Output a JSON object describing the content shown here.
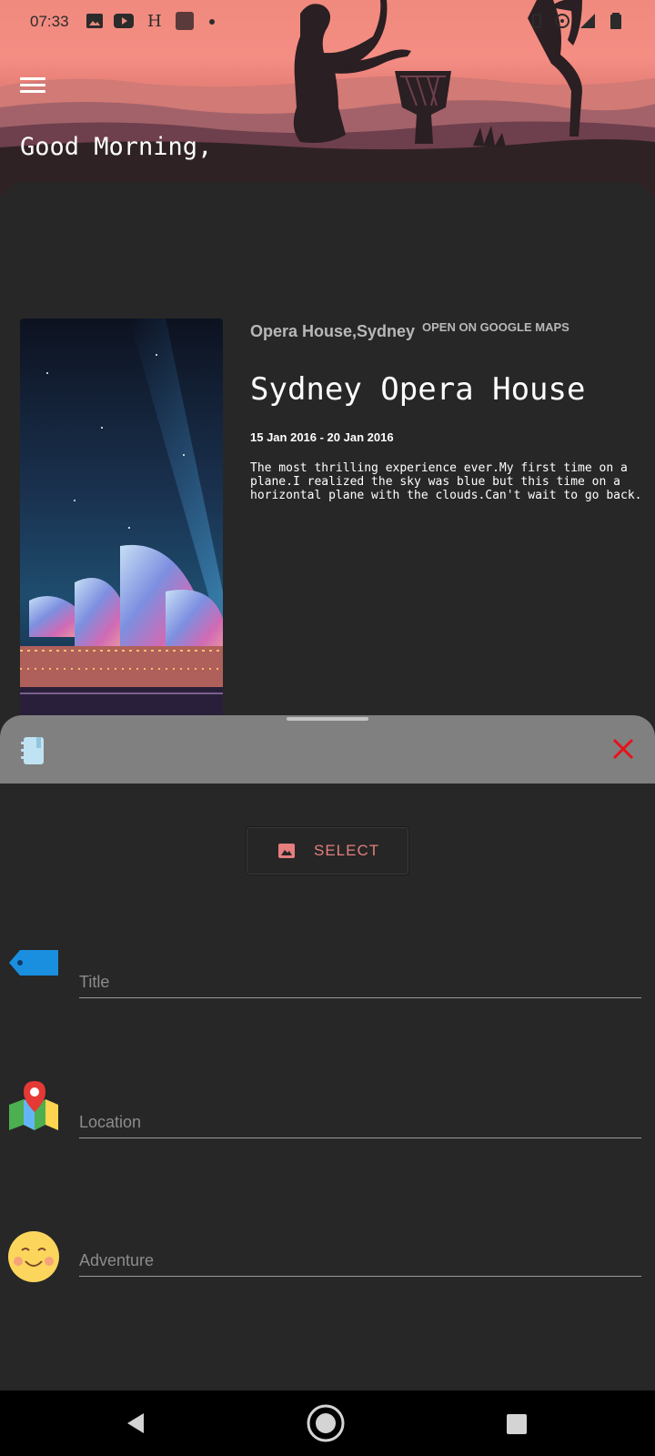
{
  "status_bar": {
    "time": "07:33",
    "icons": [
      "image-icon",
      "youtube-icon",
      "h-icon",
      "square-icon",
      "dot-icon",
      "vibrate-icon",
      "hotspot-icon",
      "signal-icon",
      "battery-icon"
    ]
  },
  "header": {
    "greeting": "Good Morning,"
  },
  "card": {
    "place": "Opera House,Sydney",
    "maps_link": "OPEN ON GOOGLE MAPS",
    "title": "Sydney Opera House",
    "dates": "15 Jan 2016 - 20 Jan 2016",
    "description": "The most thrilling experience ever.My first time on a plane.I realized the sky was blue but this time on a horizontal plane with the clouds.Can't wait to go back."
  },
  "sheet": {
    "select_label": "SELECT",
    "title_placeholder": "Title",
    "location_placeholder": "Location",
    "adventure_placeholder": "Adventure"
  },
  "colors": {
    "accent": "#e57e7e",
    "close": "#e8121a",
    "header_pink": "#f48d83",
    "background": "#272727"
  }
}
